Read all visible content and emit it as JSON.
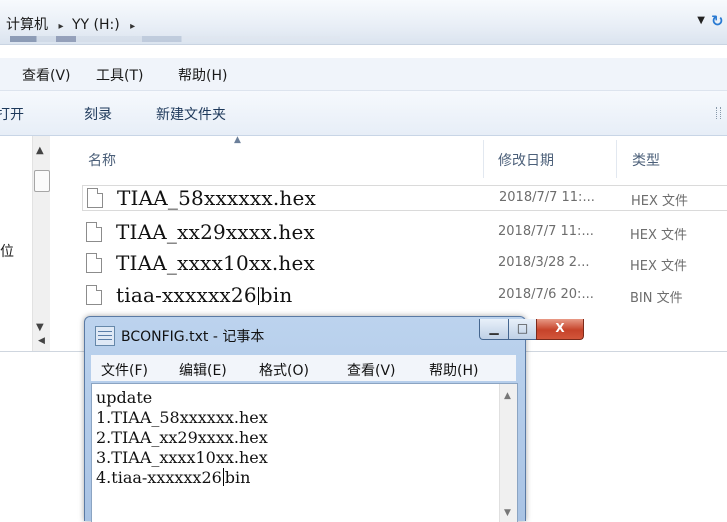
{
  "address": {
    "crumbs": [
      "计算机",
      "YY (H:)"
    ],
    "separator": "▸",
    "dropdown_icon": "▼",
    "refresh_icon": "↻"
  },
  "menubar": {
    "items": [
      "查看(V)",
      "工具(T)",
      "帮助(H)"
    ]
  },
  "toolbar": {
    "open_label": "打开",
    "burn_label": "刻录",
    "new_folder_label": "新建文件夹"
  },
  "nav": {
    "fragment": "位"
  },
  "columns": {
    "name": "名称",
    "date": "修改日期",
    "type": "类型"
  },
  "files": [
    {
      "name": "TIAA_58xxxxxx.hex",
      "date": "2018/7/7 11:...",
      "type": "HEX 文件"
    },
    {
      "name": "TIAA_xx29xxxx.hex",
      "date": "2018/7/7 11:...",
      "type": "HEX 文件"
    },
    {
      "name": "TIAA_xxxx10xx.hex",
      "date": "2018/3/28 2...",
      "type": "HEX 文件"
    },
    {
      "name_before_caret": "tiaa-xxxxxx26",
      "name_after_caret": "bin",
      "date": "2018/7/6 20:...",
      "type": "BIN 文件"
    }
  ],
  "notepad": {
    "title": "BCONFIG.txt - 记事本",
    "min_icon": "▁",
    "max_icon": "□",
    "close_icon": "X",
    "menu": [
      "文件(F)",
      "编辑(E)",
      "格式(O)",
      "查看(V)",
      "帮助(H)"
    ],
    "lines": [
      "update",
      "1.TIAA_58xxxxxx.hex",
      "2.TIAA_xx29xxxx.hex",
      "3.TIAA_xxxx10xx.hex"
    ],
    "last_line_before_caret": "4.tiaa-xxxxxx26",
    "last_line_after_caret": "bin"
  },
  "colors": {
    "close_button": "#c6432a",
    "title_bar": "#bcd3ee"
  }
}
